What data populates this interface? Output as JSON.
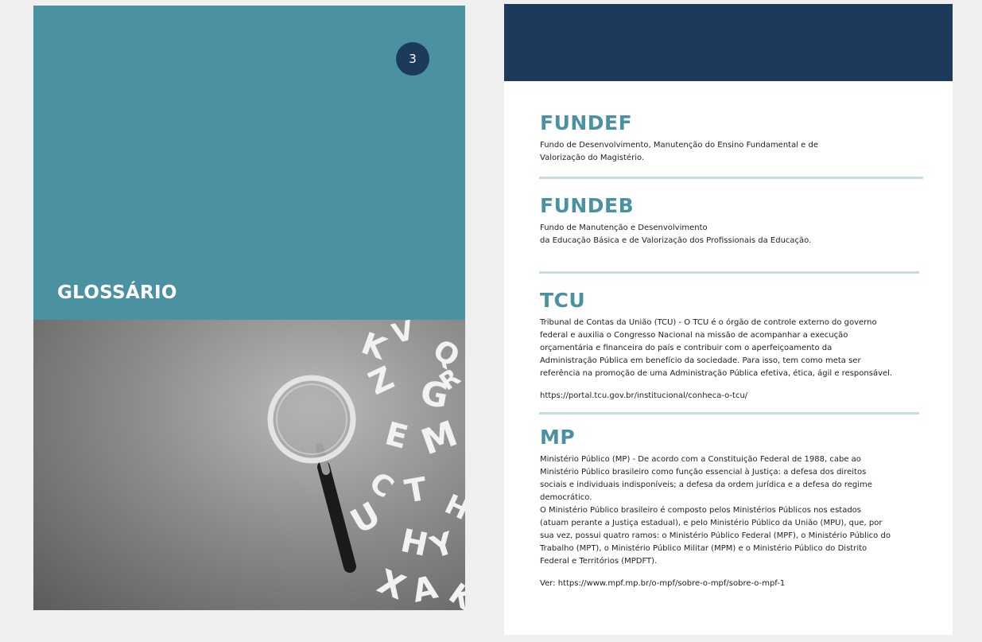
{
  "left_page": {
    "page_number": "3",
    "title": "GLOSSÁRIO",
    "photo_alt": "magnifying glass on grey background with scattered white letters"
  },
  "entries": [
    {
      "term": "FUNDEF",
      "description": "Fundo de Desenvolvimento, Manutenção do Ensino Fundamental e de\nValorização do Magistério."
    },
    {
      "term": "FUNDEB",
      "description": "Fundo de Manutenção e Desenvolvimento\nda Educação Básica e de Valorização dos Profissionais da Educação."
    },
    {
      "term": "TCU",
      "description": "Tribunal de Contas da União (TCU) - O TCU é o órgão de controle externo do governo\nfederal e auxilia o Congresso Nacional na missão de acompanhar a execução\norçamentária e financeira do país e contribuir com o aperfeiçoamento da\nAdministração Pública em benefício da sociedade. Para isso, tem como meta ser\nreferência na promoção de uma Administração Pública efetiva, ética, ágil e responsável.",
      "link": "https://portal.tcu.gov.br/institucional/conheca-o-tcu/"
    },
    {
      "term": "MP",
      "description": "Ministério Público  (MP) - De acordo com a Constituição Federal de 1988, cabe ao\nMinistério Público brasileiro como função essencial à Justiça: a defesa dos direitos\nsociais e individuais indisponíveis; a defesa da ordem jurídica e a defesa do regime\ndemocrático.\nO Ministério Público brasileiro é composto pelos Ministérios Públicos nos estados\n(atuam perante a Justiça estadual), e pelo Ministério Público da União (MPU), que, por\nsua vez, possui quatro ramos: o Ministério Público Federal (MPF), o Ministério Público do\nTrabalho (MPT), o Ministério Público Militar (MPM) e o Ministério Público do Distrito\nFederal e Territórios (MPDFT).",
      "link": "Ver: https://www.mpf.mp.br/o-mpf/sobre-o-mpf/sobre-o-mpf-1"
    }
  ],
  "colors": {
    "teal": "#4a92a2",
    "navy": "#1c3a5b",
    "divider": "#c4dde4",
    "background": "#efefef"
  }
}
